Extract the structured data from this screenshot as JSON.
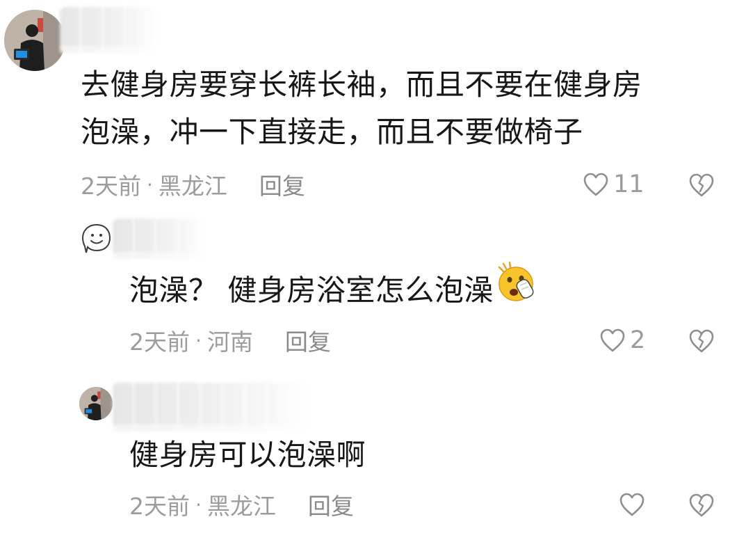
{
  "comments": [
    {
      "text_lines": [
        "去健身房要穿长裤长袖，而且不要在健身房",
        "泡澡，冲一下直接走，而且不要做椅子"
      ],
      "time": "2天前",
      "separator": "·",
      "location": "黑龙江",
      "reply_label": "回复",
      "like_count": "11"
    },
    {
      "text": "泡澡？ 健身房浴室怎么泡澡",
      "emoji_icon": "shocked-face-emoji",
      "time": "2天前",
      "separator": "·",
      "location": "河南",
      "reply_label": "回复",
      "like_count": "2"
    },
    {
      "text": "健身房可以泡澡啊",
      "time": "2天前",
      "separator": "·",
      "location": "黑龙江",
      "reply_label": "回复",
      "like_count": ""
    }
  ],
  "icons": {
    "like": "heart-outline-icon",
    "dislike": "broken-heart-icon",
    "default_avatar": "smiley-face-avatar"
  },
  "colors": {
    "text": "#171717",
    "meta": "#9c9c9c",
    "background": "#ffffff"
  }
}
